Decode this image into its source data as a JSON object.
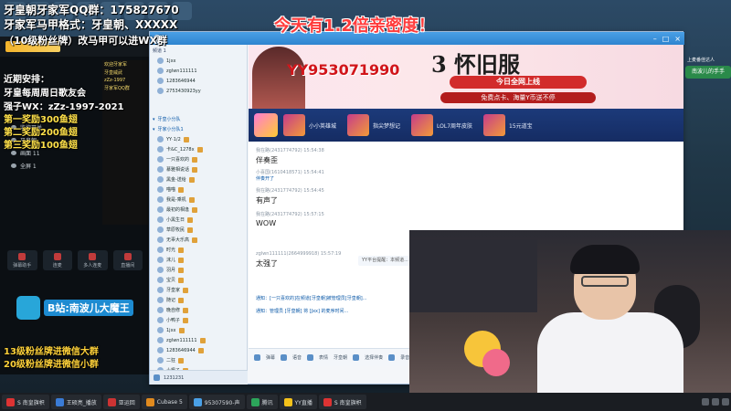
{
  "overlay": {
    "line1": "牙皇朝牙家军QQ群：175827670",
    "line2": "牙家军马甲格式：牙皇朝、XXXXX",
    "line3": "（10级粉丝牌）改马甲可以进WX群",
    "recent_title": "近期安排：",
    "recent_1": "牙皇每周周日歌友会",
    "recent_2": "强子WX：zZz-1997-2021",
    "prize_1": "第一奖励300鱼翅",
    "prize_2": "第二奖励200鱼翅",
    "prize_3": "第三奖励100鱼翅",
    "fan_1": "13级粉丝牌进微信大群",
    "fan_2": "20级粉丝牌进微信小群",
    "headline": "今天有1.2倍亲密度！",
    "bili": "B站:南波儿大魔王"
  },
  "tool_panel": {
    "rows": [
      "监控开关",
      "牙皇朝",
      "画面 11",
      "全屏 1"
    ],
    "buttons": [
      "弹幕助手",
      "连麦",
      "多人连麦",
      "直播间"
    ]
  },
  "chat_strip": [
    "欢迎牙家军",
    "牙皇威武",
    "zZz-1997",
    "牙家军QQ群"
  ],
  "yy_window": {
    "channel_head": "频道 1",
    "top_users": [
      "1jxx",
      "zglwn111111",
      "1283646944",
      "2753430923yy"
    ],
    "group_label": "牙皇小分队",
    "subgroup_label": "牙家小分队1",
    "members": [
      "YY·1/2",
      "卡&C_1278x",
      "一只喜欢的",
      "慕雅相说话",
      "黑金-送给",
      "喵喵",
      "我是-乘机",
      "最初的相逢",
      "小黑生日",
      "草原牧民",
      "无辜大乐高",
      "时光",
      "沫儿",
      "羽月",
      "宝贝",
      "牙皇家",
      "随记",
      "晚自修",
      "小鸭子",
      "1jxx",
      "zglwn111111",
      "1283646944",
      "二狂",
      "小枫子"
    ],
    "bottom_label": "1231231",
    "banner_yy": "YY953071990",
    "banner_title": "3 怀旧服",
    "banner_sub": "今日全网上线",
    "banner_sub2": "免费点卡、海量Y币送不停",
    "games": [
      "小小英雄城",
      "指尖梦想记",
      "LOL7周年皮肤",
      "15元道宝"
    ],
    "messages": [
      {
        "meta": "我在路(2431774792)   15:54:38",
        "body": "伴奏歪"
      },
      {
        "meta": "小喜国(1610418571)   15:54:41",
        "body": "伴奏开了"
      },
      {
        "meta": "我在路(2431774792)   15:54:45",
        "body": "有声了"
      },
      {
        "meta": "我在路(2431774792)   15:57:15",
        "body": "WOW"
      },
      {
        "meta": "zglwn111111(2664999918)   15:57:19",
        "body": "太强了"
      }
    ],
    "notice": "YY平台提醒：本频道...",
    "sys_1": "通知：[一只喜欢的]在频道[牙皇朝]被管理员[牙皇朝]...",
    "sys_2": "通知：管理员 [牙皇朝] 将 [Jxx] 的麦序时间...",
    "toolbar": [
      "弹幕",
      "语音",
      "表情",
      "牙皇朝",
      "选择伴奏",
      "录音"
    ]
  },
  "right_tag": {
    "label": "上麦番佳达人",
    "badge": "南波儿的手手"
  },
  "taskbar": [
    "S 南皇旗帜",
    "王硕亮_播放",
    "亚运回",
    "Cubase 5",
    "95307590-声",
    "腾讯",
    "YY直播",
    "S 南皇旗帜"
  ]
}
